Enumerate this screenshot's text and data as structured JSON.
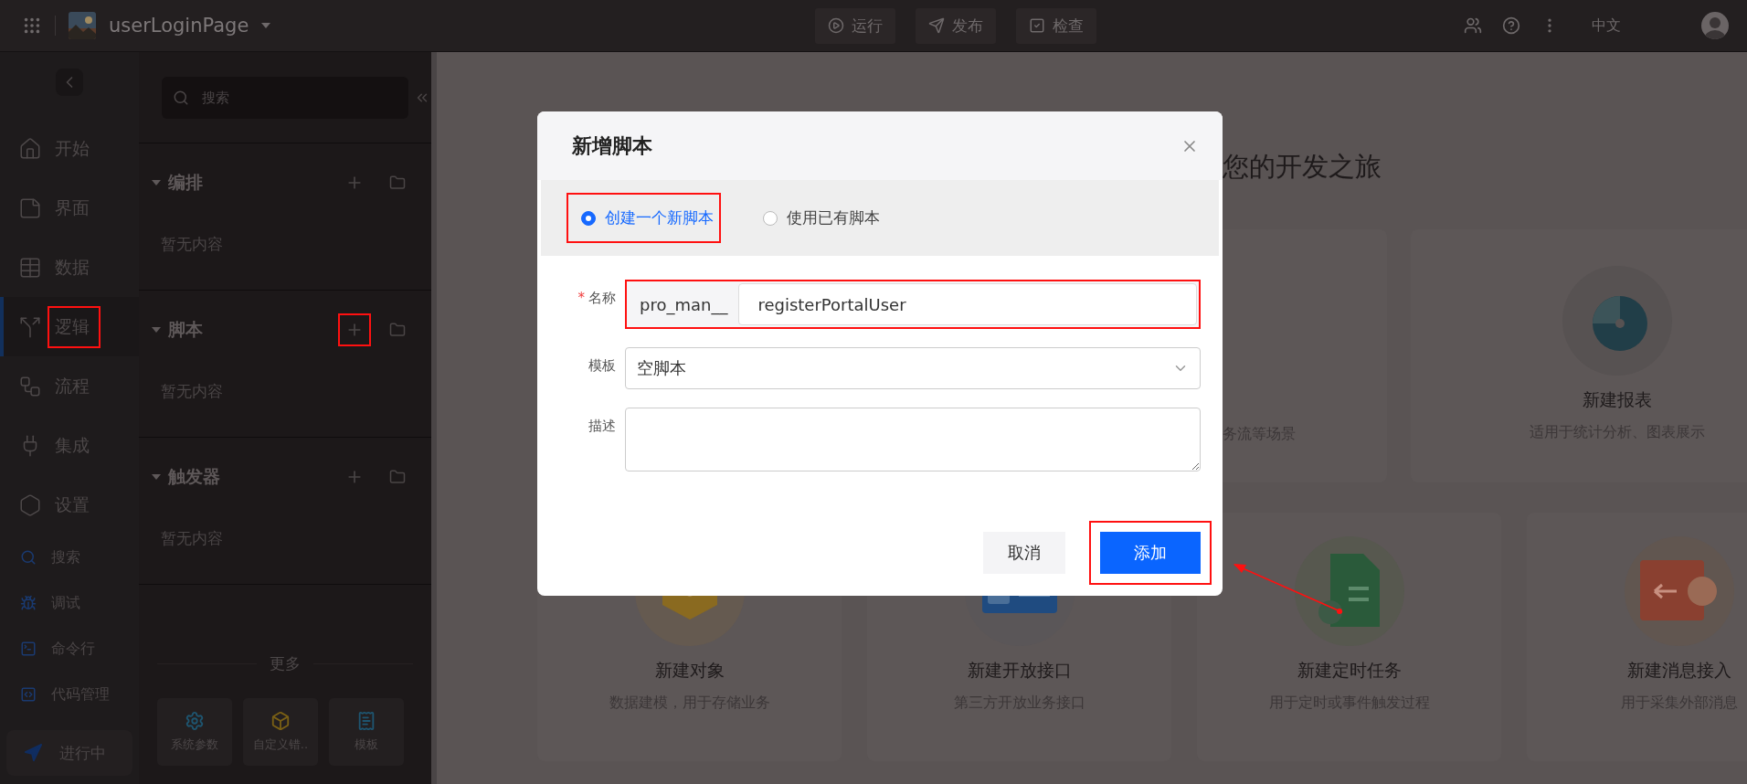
{
  "topbar": {
    "app_name": "userLoginPage",
    "actions": [
      {
        "label": "运行",
        "kind": "run"
      },
      {
        "label": "发布",
        "kind": "publish"
      },
      {
        "label": "检查",
        "kind": "check"
      }
    ],
    "language": "中文"
  },
  "nav": {
    "items": [
      {
        "label": "开始",
        "kind": "home",
        "selected": false,
        "annotated": false
      },
      {
        "label": "界面",
        "kind": "page",
        "selected": false,
        "annotated": false
      },
      {
        "label": "数据",
        "kind": "table",
        "selected": false,
        "annotated": false
      },
      {
        "label": "逻辑",
        "kind": "logic",
        "selected": true,
        "annotated": true
      },
      {
        "label": "流程",
        "kind": "flow",
        "selected": false,
        "annotated": false
      },
      {
        "label": "集成",
        "kind": "plug",
        "selected": false,
        "annotated": false
      },
      {
        "label": "设置",
        "kind": "settings",
        "selected": false,
        "annotated": false
      }
    ],
    "tools": [
      {
        "label": "搜索",
        "kind": "search"
      },
      {
        "label": "调试",
        "kind": "debug"
      },
      {
        "label": "命令行",
        "kind": "terminal"
      },
      {
        "label": "代码管理",
        "kind": "code"
      }
    ],
    "status": "进行中"
  },
  "panel": {
    "search": {
      "placeholder": "搜索"
    },
    "sections": [
      {
        "title": "编排",
        "empty_text": "暂无内容",
        "expanded": true,
        "add_annotated": false
      },
      {
        "title": "脚本",
        "empty_text": "暂无内容",
        "expanded": true,
        "add_annotated": true
      },
      {
        "title": "触发器",
        "empty_text": "暂无内容",
        "expanded": true,
        "add_annotated": false
      }
    ],
    "more": {
      "title": "更多",
      "tiles": [
        {
          "label": "系统参数",
          "kind": "settings"
        },
        {
          "label": "自定义错..",
          "kind": "error"
        },
        {
          "label": "模板",
          "kind": "template"
        }
      ]
    }
  },
  "main": {
    "heading": "您的开发之旅",
    "top_cards": [
      {
        "kind": "partial",
        "subtitle": "务流等场景"
      },
      {
        "kind": "report",
        "title": "新建报表",
        "subtitle": "适用于统计分析、图表展示"
      }
    ],
    "bottom_cards": [
      {
        "kind": "object",
        "title": "新建对象",
        "subtitle": "数据建模，用于存储业务"
      },
      {
        "kind": "api",
        "title": "新建开放接口",
        "subtitle": "第三方开放业务接口"
      },
      {
        "kind": "timer",
        "title": "新建定时任务",
        "subtitle": "用于定时或事件触发过程"
      },
      {
        "kind": "message",
        "title": "新建消息接入",
        "subtitle": "用于采集外部消息"
      }
    ]
  },
  "dialog": {
    "title": "新增脚本",
    "modes": [
      {
        "label": "创建一个新脚本",
        "selected": true,
        "annotated": true
      },
      {
        "label": "使用已有脚本",
        "selected": false,
        "annotated": false
      }
    ],
    "fields": [
      {
        "kind": "prefixed",
        "label": "名称",
        "required_mark": "*",
        "prefix": "pro_man__",
        "value": "registerPortalUser",
        "annotated": true
      },
      {
        "kind": "select",
        "label": "模板",
        "value": "空脚本",
        "annotated": false
      },
      {
        "kind": "textarea",
        "label": "描述",
        "annotated": false
      }
    ],
    "buttons": [
      {
        "label": "取消",
        "kind": "secondary",
        "annotated": false
      },
      {
        "label": "添加",
        "kind": "primary",
        "annotated": true
      }
    ]
  }
}
